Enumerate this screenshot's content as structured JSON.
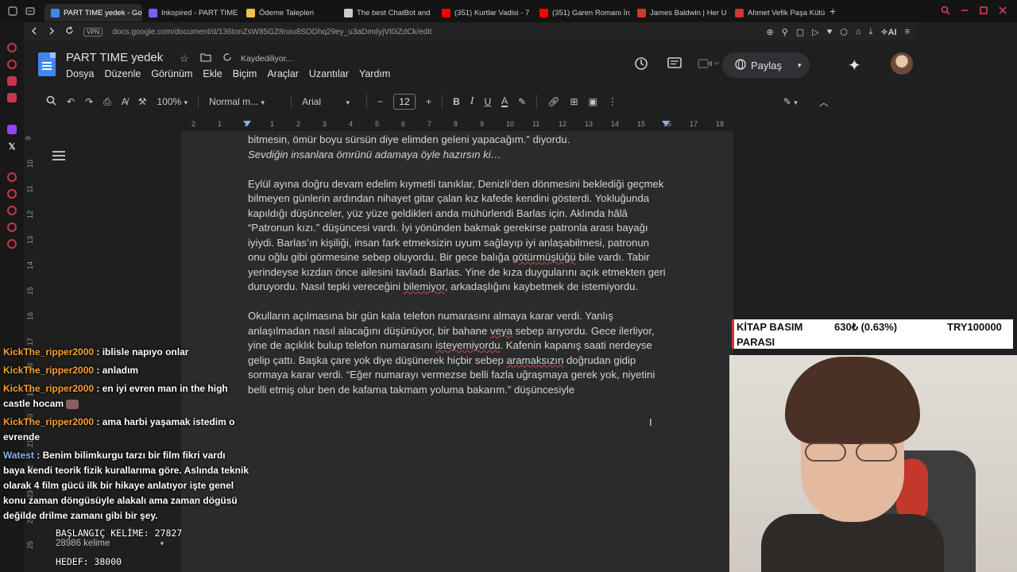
{
  "browser": {
    "tabs": [
      {
        "label": "PART TIME yedek - Googl",
        "color": "#4285f4",
        "active": true
      },
      {
        "label": "Inkspired - PART TIME",
        "color": "#7b5cff",
        "active": false
      },
      {
        "label": "Ödeme Talepleri",
        "color": "#f2c14e",
        "active": false
      },
      {
        "label": "The best ChatBot and",
        "color": "#cccccc",
        "active": false
      },
      {
        "label": "(351) Kurtlar Vadisi - 7",
        "color": "#ff0000",
        "active": false
      },
      {
        "label": "(351) Garen Romanı İn",
        "color": "#ff0000",
        "active": false
      },
      {
        "label": "James Baldwin | Her U",
        "color": "#d23333",
        "active": false
      },
      {
        "label": "Ahmet Vefik Paşa Kütü",
        "color": "#d23333",
        "active": false
      }
    ],
    "new_tab": "+",
    "vpn_label": "VPN",
    "url": "docs.google.com/document/d/136tonZsW85GZ8nxu8SODhq29ey_u3aDmdyjVt0iZdCk/edit",
    "ai_label": "AI"
  },
  "docs": {
    "title": "PART TIME  yedek",
    "saving_status": "Kaydediliyor...",
    "menu": [
      "Dosya",
      "Düzenle",
      "Görünüm",
      "Ekle",
      "Biçim",
      "Araçlar",
      "Uzantılar",
      "Yardım"
    ],
    "share_label": "Paylaş",
    "toolbar": {
      "zoom": "100%",
      "style": "Normal m...",
      "font": "Arial",
      "font_size": "12"
    },
    "ruler_ticks": [
      "2",
      "1",
      "1",
      "1",
      "2",
      "3",
      "4",
      "5",
      "6",
      "7",
      "8",
      "9",
      "10",
      "11",
      "12",
      "13",
      "14",
      "15",
      "16",
      "17",
      "18"
    ],
    "vruler_ticks": [
      "9",
      "10",
      "11",
      "12",
      "13",
      "14",
      "15",
      "16",
      "17",
      "18",
      "19",
      "20",
      "21",
      "22",
      "23",
      "24",
      "25"
    ],
    "paragraphs": [
      {
        "segments": [
          {
            "t": "bitmesin, ömür boyu sürsün diye elimden geleni yapacağım.” diyordu."
          }
        ]
      },
      {
        "segments": [
          {
            "t": "Sevdiğin insanlara ömrünü adamaya öyle hazırsın ki…",
            "italic": true
          }
        ],
        "tight": true
      },
      {
        "segments": [
          {
            "t": "Eylül ayına doğru devam edelim kıymetli tanıklar, Denizli’den dönmesini beklediği geçmek bilmeyen günlerin ardından nihayet gitar çalan kız kafede kendini gösterdi. Yokluğunda kapıldığı düşünceler, yüz yüze geldikleri anda mühürlendi Barlas için. Aklında hâlâ “Patronun kızı.” düşüncesi vardı. İyi yönünden bakmak gerekirse patronla arası bayağı iyiydi. Barlas’ın kişiliği, insan fark etmeksizin uyum sağlayıp iyi anlaşabilmesi, patronun onu oğlu gibi görmesine sebep oluyordu. Bir gece balığa "
          },
          {
            "t": "götürmüşlüğü",
            "sq": true
          },
          {
            "t": " bile vardı. Tabir yerindeyse kızdan önce ailesini tavladı Barlas. Yine de kıza duygularını açık etmekten geri duruyordu. Nasıl tepki vereceğini "
          },
          {
            "t": "bilemiyor",
            "sq": true
          },
          {
            "t": ", arkadaşlığını kaybetmek de istemiyordu."
          }
        ]
      },
      {
        "segments": [
          {
            "t": "Okulların açılmasına bir gün kala telefon numarasını almaya karar verdi. Yanlış anlaşılmadan nasıl alacağını düşünüyor, bir bahane "
          },
          {
            "t": "veya",
            "sq": true
          },
          {
            "t": " sebep arıyordu. Gece ilerliyor, yine de açıklık bulup telefon numarasını "
          },
          {
            "t": "isteyemiyordu",
            "sq": true
          },
          {
            "t": ". Kafenin kapanış saati nerdeyse gelip çattı. Başka çare yok diye düşünerek hiçbir sebep "
          },
          {
            "t": "aramaksızın",
            "sq": true
          },
          {
            "t": " doğrudan gidip sormaya karar verdi. “Eğer numarayı vermezse belli fazla uğraşmaya gerek yok, niyetini belli etmiş olur ben de kafama takmam yoluma bakarım.” düşüncesiyle"
          }
        ]
      }
    ]
  },
  "chat": [
    {
      "user": "KickThe_ripper2000",
      "text": " : iblisle napıyo onlar",
      "color": "#ff9f2e"
    },
    {
      "user": "KickThe_ripper2000",
      "text": " : anladım",
      "color": "#ff9f2e"
    },
    {
      "user": "KickThe_ripper2000",
      "text": " : en iyi evren man in the high castle hocam",
      "color": "#ff9f2e",
      "emote": true
    },
    {
      "user": "KickThe_ripper2000",
      "text": " : ama harbi yaşamak istedim o evrende",
      "color": "#ff9f2e"
    },
    {
      "user": "Watest",
      "text": " : Benim bilimkurgu tarzı bir film fikri vardı baya kendi teorik fizik kurallarıma göre. Aslında teknik olarak 4 film gücü ilk bir hikaye anlatıyor işte genel konu zaman döngüsüyle alakalı ama zaman dögüsü değilde drilme zamanı gibi bir şey.",
      "color": "#8ab4f8"
    }
  ],
  "overlay": {
    "start_words": "BAŞLANGIÇ KELİME: 27827",
    "word_count": "28986 kelime",
    "goal": "HEDEF: 38000"
  },
  "kitap_widget": {
    "line1": "KİTAP BASIM",
    "line2": "PARASI",
    "amount": "630₺ (0.63%)",
    "target": "TRY100000",
    "progress_percent": 0.63
  },
  "colors": {
    "accent_red": "#d23333",
    "docs_blue": "#4285f4"
  }
}
